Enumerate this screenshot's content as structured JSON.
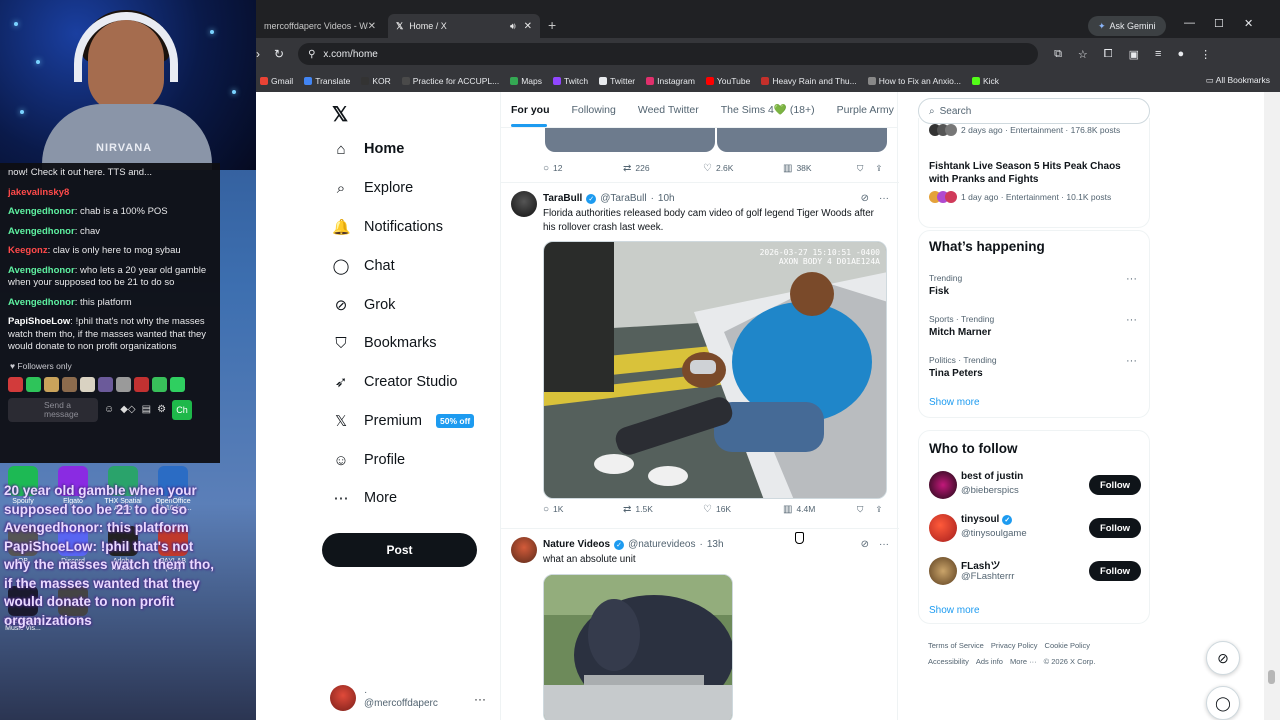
{
  "overlay": {
    "chat_top_text": "now! Check it out here. TTS and...",
    "chat_top_user": "jakevalinsky8",
    "chat": [
      {
        "user": "Avengedhonor",
        "text": "chab is a 100% POS",
        "color": "u-green"
      },
      {
        "user": "Avengedhonor",
        "text": "chav",
        "color": "u-green"
      },
      {
        "user": "Keegonz",
        "text": "clav is only here to mog sybau",
        "color": "u-red"
      },
      {
        "user": "Avengedhonor",
        "text": "who lets a 20 year old gamble when your supposed too be 21 to do so",
        "color": "u-green"
      },
      {
        "user": "Avengedhonor",
        "text": "this platform",
        "color": "u-green"
      },
      {
        "user": "PapiShoeLow",
        "text": "!phil that's not why the masses watch them tho, if the masses wanted that they would donate to non profit organizations",
        "color": "u-white"
      }
    ],
    "followers_only": "Followers only",
    "send_placeholder": "Send a message",
    "send_button": "Ch",
    "shirt_text": "NIRVANA",
    "desktop_icons": [
      "Spotify",
      "Elgato",
      "THX Spatial Audio",
      "OpenOffice 4.1.16 (en...",
      "OB",
      "Discord",
      "Adobe Reader",
      "PAYLAB (x64)",
      "ViseQ31 3D Music Vis...",
      "The Pan"
    ],
    "caption": "20 year old gamble when your supposed too be 21 to do so Avengedhonor: this platform PapiShoeLow: !phil that's not why the masses watch them tho, if the masses wanted that they would donate to non profit organizations"
  },
  "browser": {
    "tabs": [
      {
        "label": "mercoffdaperc Videos - Watch",
        "active": false
      },
      {
        "label": "Home / X",
        "active": true
      }
    ],
    "new_tab": "+",
    "ask_gemini": "Ask Gemini",
    "url": "x.com/home",
    "bookmarks": [
      "Gmail",
      "Translate",
      "KOR",
      "Practice for ACCUPL...",
      "Maps",
      "Twitch",
      "Twitter",
      "Instagram",
      "YouTube",
      "Heavy Rain and Thu...",
      "How to Fix an Anxio...",
      "Kick"
    ],
    "all_bookmarks": "All Bookmarks"
  },
  "x": {
    "logo": "𝕏",
    "nav": [
      {
        "label": "Home",
        "icon": "home-icon",
        "glyph": "⌂",
        "active": true
      },
      {
        "label": "Explore",
        "icon": "search-icon",
        "glyph": "⌕",
        "active": false
      },
      {
        "label": "Notifications",
        "icon": "bell-icon",
        "glyph": "🔔",
        "active": false
      },
      {
        "label": "Chat",
        "icon": "chat-icon",
        "glyph": "◯",
        "active": false
      },
      {
        "label": "Grok",
        "icon": "grok-icon",
        "glyph": "⊘",
        "active": false
      },
      {
        "label": "Bookmarks",
        "icon": "bookmark-icon",
        "glyph": "⛉",
        "active": false
      },
      {
        "label": "Creator Studio",
        "icon": "rocket-icon",
        "glyph": "➶",
        "active": false
      },
      {
        "label": "Premium",
        "icon": "x-premium-icon",
        "glyph": "𝕏",
        "active": false
      },
      {
        "label": "Profile",
        "icon": "person-icon",
        "glyph": "☺",
        "active": false
      },
      {
        "label": "More",
        "icon": "more-circle-icon",
        "glyph": "⋯",
        "active": false
      }
    ],
    "premium_badge": "50% off",
    "post_button": "Post",
    "account_handle": "@mercoffdaperc",
    "account_name": "·",
    "feed_tabs": [
      "For you",
      "Following",
      "Weed Twitter",
      "The Sims 4💚 (18+)",
      "Purple Army"
    ],
    "top_stats": {
      "replies": "12",
      "reposts": "226",
      "likes": "2.6K",
      "views": "38K"
    },
    "tweets": [
      {
        "name": "TaraBull",
        "handle": "@TaraBull",
        "time": "10h",
        "text": "Florida authorities released body cam video of golf legend Tiger Woods after his rollover crash last week.",
        "media_caption": "2026-03-27 15:10:51 -0400 AXON BODY 4 D01AE124A",
        "replies": "1K",
        "reposts": "1.5K",
        "likes": "16K",
        "views": "4.4M"
      },
      {
        "name": "Nature Videos",
        "handle": "@naturevideos",
        "time": "13h",
        "text": "what an absolute unit"
      }
    ],
    "search_placeholder": "Search",
    "top_trend": {
      "meta": "2 days ago · Entertainment · 176.8K posts"
    },
    "fishtank": {
      "title": "Fishtank Live Season 5 Hits Peak Chaos with Pranks and Fights",
      "meta": "1 day ago · Entertainment · 10.1K posts"
    },
    "whats_happening": "What’s happening",
    "trends": [
      {
        "context": "Trending",
        "name": "Fisk"
      },
      {
        "context": "Sports · Trending",
        "name": "Mitch Marner"
      },
      {
        "context": "Politics · Trending",
        "name": "Tina Peters"
      }
    ],
    "show_more": "Show more",
    "who_to_follow": "Who to follow",
    "follow_suggestions": [
      {
        "name": "best of justin",
        "handle": "@bieberspics",
        "verified": false
      },
      {
        "name": "tinysoul",
        "handle": "@tinysoulgame",
        "verified": true
      },
      {
        "name": "FLashツ",
        "handle": "@FLashterrr",
        "verified": false
      }
    ],
    "follow_label": "Follow",
    "footer": [
      "Terms of Service",
      "Privacy Policy",
      "Cookie Policy",
      "Accessibility",
      "Ads info",
      "More ···",
      "© 2026 X Corp."
    ]
  }
}
